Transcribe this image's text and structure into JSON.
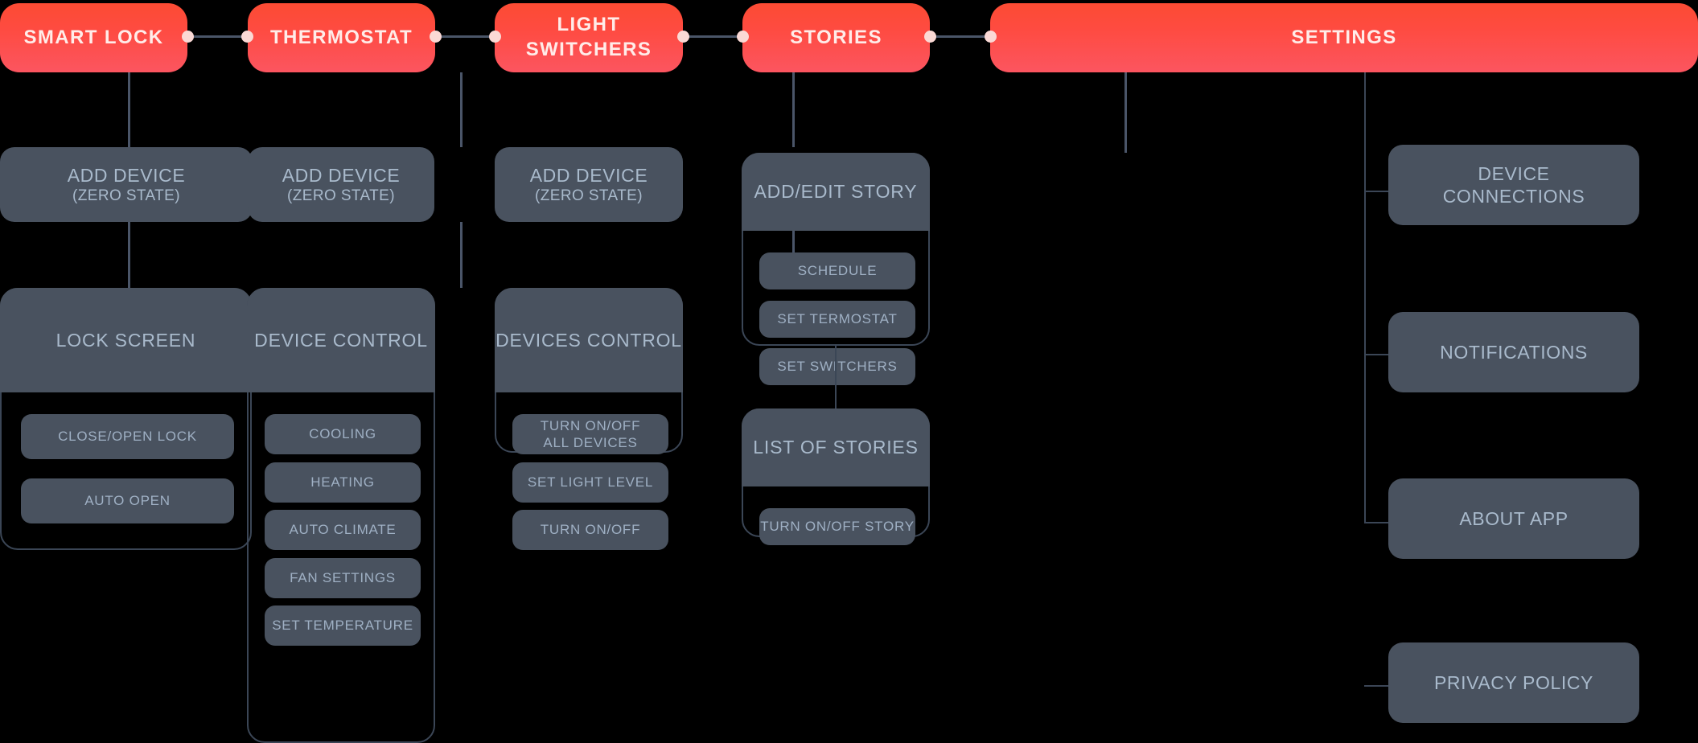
{
  "diagram": {
    "title": "Smart Home App Sitemap",
    "colors": {
      "background": "#000000",
      "top_card_gradient_start": "#FC4B33",
      "top_card_gradient_end": "#FC5560",
      "top_card_text": "#FFECE9",
      "card_fill": "#49525F",
      "card_text": "#A9BACC",
      "connector_line": "#4A5568",
      "connector_dot": "#FBD9D5",
      "group_border": "#3B4656"
    },
    "top_level": [
      {
        "id": "smart-lock",
        "label": "SMART LOCK"
      },
      {
        "id": "thermostat",
        "label": "THERMOSTAT"
      },
      {
        "id": "light-switchers",
        "label": "LIGHT\nSWITCHERS",
        "line1": "LIGHT",
        "line2": "SWITCHERS"
      },
      {
        "id": "stories",
        "label": "STORIES"
      },
      {
        "id": "settings",
        "label": "SETTINGS"
      }
    ],
    "columns": {
      "smart_lock": {
        "add_device": {
          "title": "ADD DEVICE",
          "subtitle": "(ZERO STATE)"
        },
        "screen": {
          "title": "LOCK  SCREEN",
          "items": [
            "CLOSE/OPEN LOCK",
            "AUTO OPEN"
          ]
        }
      },
      "thermostat": {
        "add_device": {
          "title": "ADD DEVICE",
          "subtitle": "(ZERO STATE)"
        },
        "screen": {
          "title": "DEVICE CONTROL",
          "items": [
            "COOLING",
            "HEATING",
            "AUTO CLIMATE",
            "FAN SETTINGS",
            "SET TEMPERATURE"
          ]
        }
      },
      "light_switchers": {
        "add_device": {
          "title": "ADD DEVICE",
          "subtitle": "(ZERO STATE)"
        },
        "screen": {
          "title": "DEVICES CONTROL",
          "items": [
            "TURN ON/OFF\nALL DEVICES",
            "SET LIGHT LEVEL",
            "TURN ON/OFF"
          ],
          "item_lines": [
            [
              "TURN ON/OFF",
              "ALL DEVICES"
            ],
            [
              "SET LIGHT LEVEL"
            ],
            [
              "TURN ON/OFF"
            ]
          ]
        }
      },
      "stories": {
        "editor": {
          "title": "ADD/EDIT STORY",
          "items": [
            "SCHEDULE",
            "SET TERMOSTAT",
            "SET SWITCHERS"
          ]
        },
        "list": {
          "title": "LIST OF STORIES",
          "items": [
            "TURN ON/OFF STORY"
          ]
        }
      },
      "settings": {
        "items": [
          {
            "label": "DEVICE\nCONNECTIONS",
            "line1": "DEVICE",
            "line2": "CONNECTIONS"
          },
          {
            "label": "NOTIFICATIONS",
            "line1": "NOTIFICATIONS",
            "line2": ""
          },
          {
            "label": "ABOUT APP",
            "line1": "ABOUT APP",
            "line2": ""
          },
          {
            "label": "PRIVACY POLICY",
            "line1": "PRIVACY POLICY",
            "line2": ""
          }
        ]
      }
    }
  }
}
